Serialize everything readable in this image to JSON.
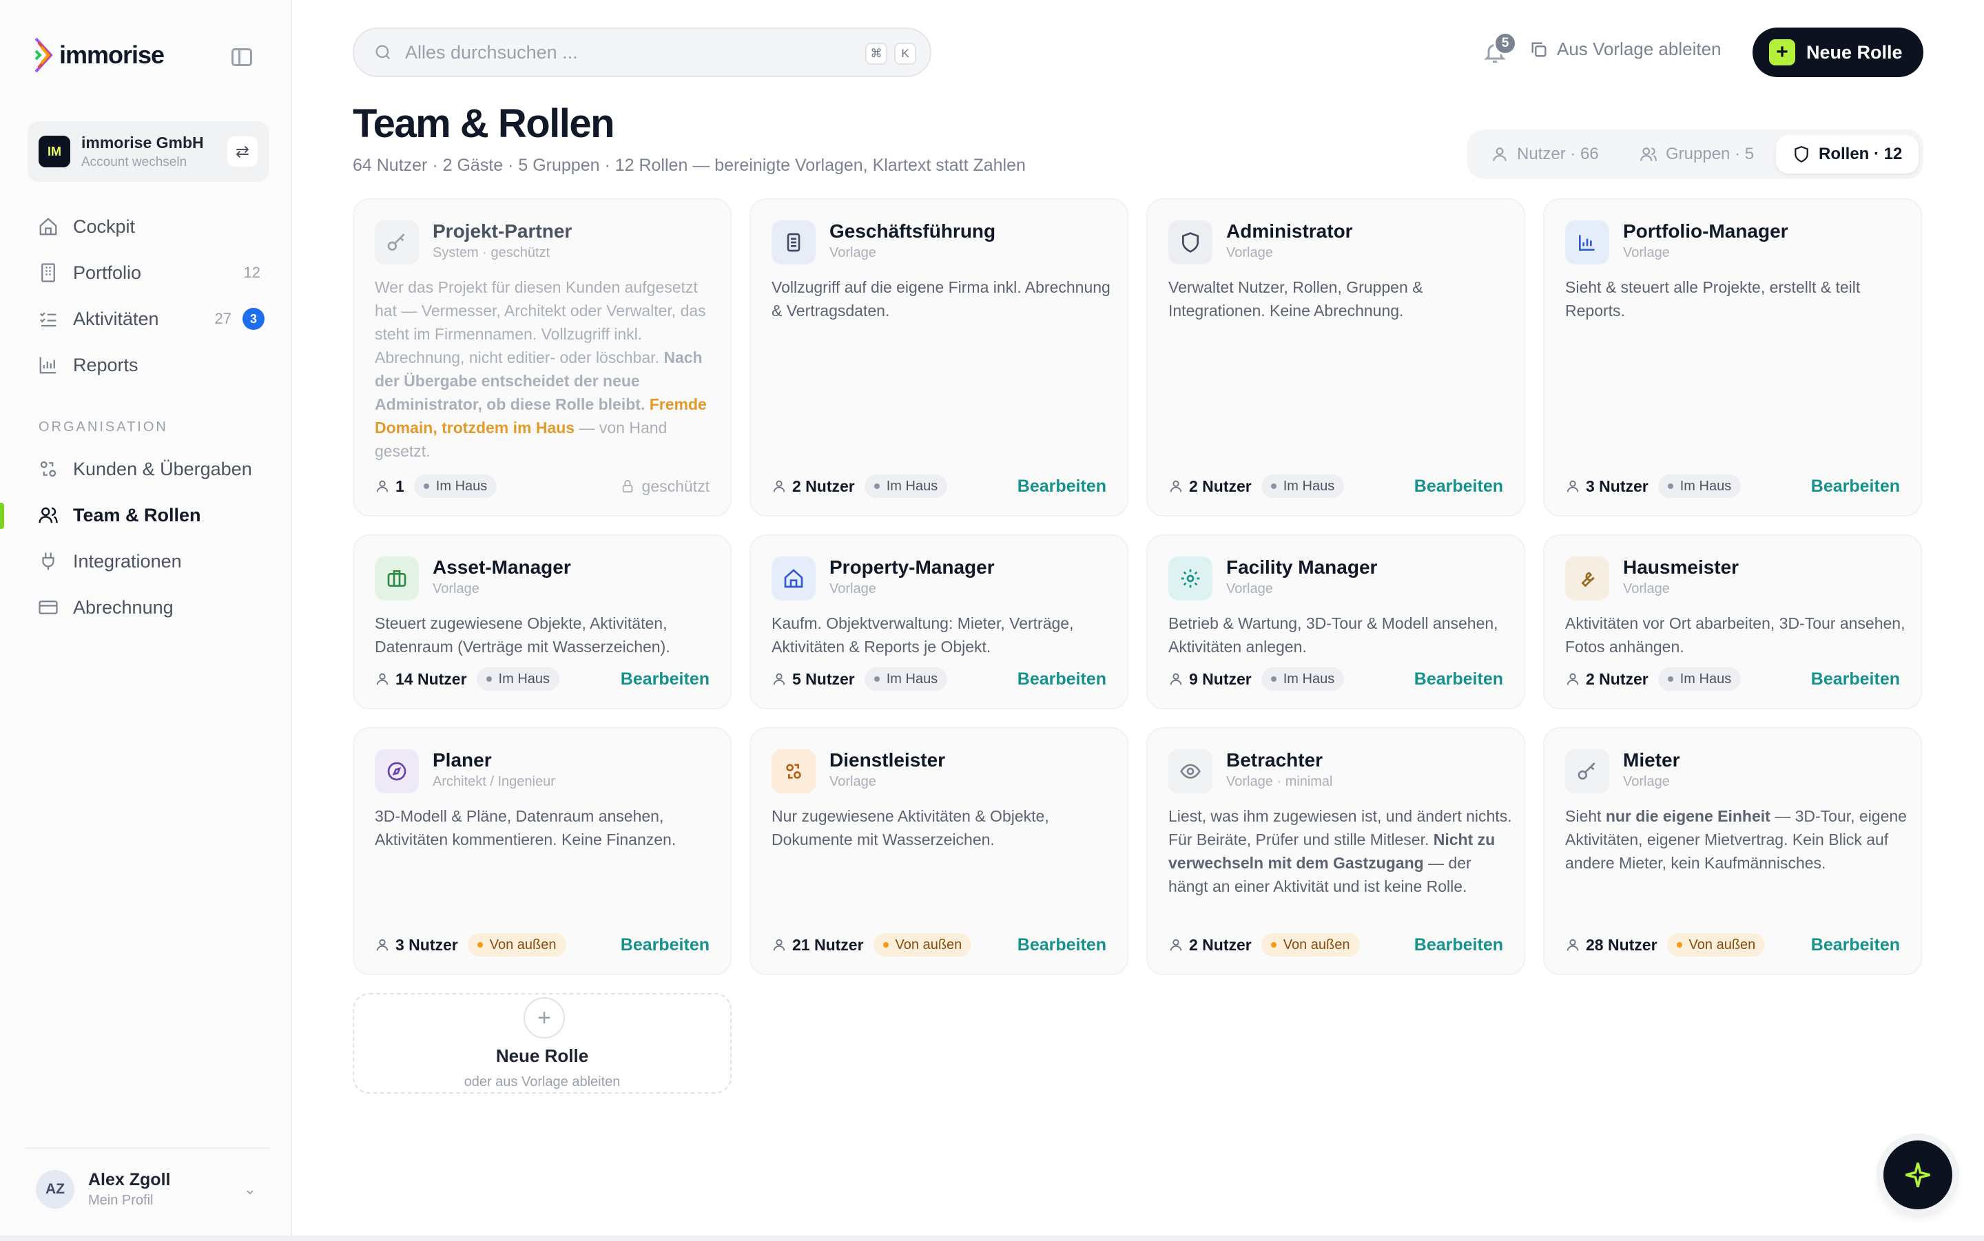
{
  "brand": {
    "name": "immorise"
  },
  "account": {
    "initials": "IM",
    "name": "immorise GmbH",
    "action": "Account wechseln"
  },
  "nav": {
    "items": [
      {
        "label": "Cockpit"
      },
      {
        "label": "Portfolio",
        "count": "12"
      },
      {
        "label": "Aktivitäten",
        "count": "27",
        "badge": "3"
      },
      {
        "label": "Reports"
      }
    ],
    "section_label": "ORGANISATION",
    "org_items": [
      {
        "label": "Kunden & Übergaben"
      },
      {
        "label": "Team & Rollen"
      },
      {
        "label": "Integrationen"
      },
      {
        "label": "Abrechnung"
      }
    ]
  },
  "profile": {
    "initials": "AZ",
    "name": "Alex Zgoll",
    "sub": "Mein Profil"
  },
  "search": {
    "placeholder": "Alles durchsuchen ...",
    "kbd1": "⌘",
    "kbd2": "K"
  },
  "topbar": {
    "notifications": "5",
    "derive_label": "Aus Vorlage ableiten",
    "new_role_label": "Neue Rolle"
  },
  "header": {
    "title": "Team & Rollen",
    "subtitle": "64 Nutzer · 2 Gäste · 5 Gruppen · 12 Rollen — bereinigte Vorlagen, Klartext statt Zahlen"
  },
  "tabs": [
    {
      "label": "Nutzer · 66"
    },
    {
      "label": "Gruppen · 5"
    },
    {
      "label": "Rollen · 12",
      "active": true
    }
  ],
  "cards": [
    {
      "title": "Projekt-Partner",
      "kind": "System · geschützt",
      "users": "1",
      "pill": "Im Haus",
      "locked": "geschützt",
      "desc_parts": [
        "Wer das Projekt für diesen Kunden aufgesetzt hat — Vermesser, Architekt oder Verwalter, das steht im Firmennamen. Vollzugriff inkl. Abrechnung, nicht editier- oder löschbar. ",
        "Nach der Übergabe entscheidet der neue Administrator, ob diese Rolle bleibt.",
        " ",
        "Fremde Domain, trotzdem im Haus",
        " — von Hand gesetzt."
      ]
    },
    {
      "title": "Geschäftsführung",
      "kind": "Vorlage",
      "desc": "Vollzugriff auf die eigene Firma inkl. Abrechnung & Vertragsdaten.",
      "users": "2 Nutzer",
      "pill": "Im Haus",
      "edit": "Bearbeiten"
    },
    {
      "title": "Administrator",
      "kind": "Vorlage",
      "desc": "Verwaltet Nutzer, Rollen, Gruppen & Integrationen. Keine Abrechnung.",
      "users": "2 Nutzer",
      "pill": "Im Haus",
      "edit": "Bearbeiten"
    },
    {
      "title": "Portfolio-Manager",
      "kind": "Vorlage",
      "desc": "Sieht & steuert alle Projekte, erstellt & teilt Reports.",
      "users": "3 Nutzer",
      "pill": "Im Haus",
      "edit": "Bearbeiten"
    },
    {
      "title": "Asset-Manager",
      "kind": "Vorlage",
      "desc": "Steuert zugewiesene Objekte, Aktivitäten, Datenraum (Verträge mit Wasserzeichen).",
      "users": "14 Nutzer",
      "pill": "Im Haus",
      "edit": "Bearbeiten"
    },
    {
      "title": "Property-Manager",
      "kind": "Vorlage",
      "desc": "Kaufm. Objektverwaltung: Mieter, Verträge, Aktivitäten & Reports je Objekt.",
      "users": "5 Nutzer",
      "pill": "Im Haus",
      "edit": "Bearbeiten"
    },
    {
      "title": "Facility Manager",
      "kind": "Vorlage",
      "desc": "Betrieb & Wartung, 3D-Tour & Modell ansehen, Aktivitäten anlegen.",
      "users": "9 Nutzer",
      "pill": "Im Haus",
      "edit": "Bearbeiten"
    },
    {
      "title": "Hausmeister",
      "kind": "Vorlage",
      "desc": "Aktivitäten vor Ort abarbeiten, 3D-Tour ansehen, Fotos anhängen.",
      "users": "2 Nutzer",
      "pill": "Im Haus",
      "edit": "Bearbeiten"
    },
    {
      "title": "Planer",
      "kind": "Architekt / Ingenieur",
      "desc": "3D-Modell & Pläne, Datenraum ansehen, Aktivitäten kommentieren. Keine Finanzen.",
      "users": "3 Nutzer",
      "pill": "Von außen",
      "edit": "Bearbeiten"
    },
    {
      "title": "Dienstleister",
      "kind": "Vorlage",
      "desc": "Nur zugewiesene Aktivitäten & Objekte, Dokumente mit Wasserzeichen.",
      "users": "21 Nutzer",
      "pill": "Von außen",
      "edit": "Bearbeiten"
    },
    {
      "title": "Betrachter",
      "kind": "Vorlage · minimal",
      "users": "2 Nutzer",
      "pill": "Von außen",
      "edit": "Bearbeiten",
      "desc_parts": [
        "Liest, was ihm zugewiesen ist, und ändert nichts. Für Beiräte, Prüfer und stille Mitleser. ",
        "Nicht zu verwechseln mit dem Gastzugang",
        " — der hängt an einer Aktivität und ist keine Rolle."
      ]
    },
    {
      "title": "Mieter",
      "kind": "Vorlage",
      "users": "28 Nutzer",
      "pill": "Von außen",
      "edit": "Bearbeiten",
      "desc_parts": [
        "Sieht ",
        "nur die eigene Einheit",
        " — 3D-Tour, eigene Aktivitäten, eigener Mietvertrag. Kein Blick auf andere Mieter, kein Kaufmännisches."
      ]
    }
  ],
  "new_card": {
    "plus": "+",
    "title": "Neue Rolle",
    "sub": "oder aus Vorlage ableiten"
  },
  "colors": {
    "accent": "#b4f13d",
    "dark": "#0c1220",
    "link": "#17918c",
    "badge_blue": "#1e6ff0",
    "external": "#f39c12"
  }
}
